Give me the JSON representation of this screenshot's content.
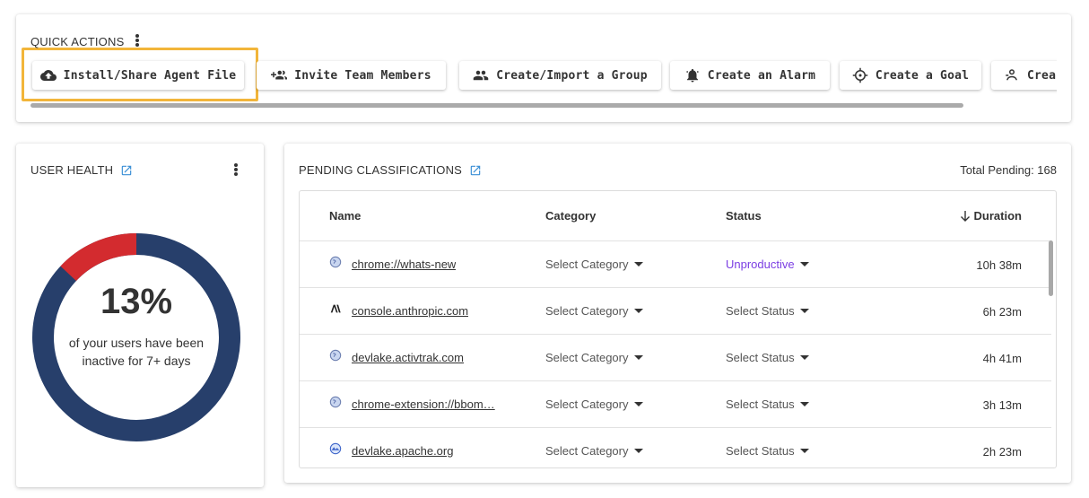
{
  "quick_actions": {
    "title": "QUICK ACTIONS",
    "buttons": [
      {
        "label": "Install/Share Agent File",
        "icon": "cloud-upload-icon"
      },
      {
        "label": "Invite Team Members",
        "icon": "add-people-icon"
      },
      {
        "label": "Create/Import a Group",
        "icon": "group-icon"
      },
      {
        "label": "Create an Alarm",
        "icon": "alarm-bell-icon"
      },
      {
        "label": "Create a Goal",
        "icon": "crosshair-icon"
      },
      {
        "label": "Crea",
        "icon": "person-badge-icon"
      }
    ],
    "highlight_color": "#f2b53a"
  },
  "user_health": {
    "title": "USER HEALTH",
    "percent": "13%",
    "percent_value": 13,
    "description": "of your users have been inactive for 7+ days",
    "colors": {
      "inactive": "#d32b2f",
      "active": "#273f6b"
    }
  },
  "pending": {
    "title": "PENDING CLASSIFICATIONS",
    "total_label": "Total Pending: 168",
    "columns": {
      "name": "Name",
      "category": "Category",
      "status": "Status",
      "duration": "Duration"
    },
    "rows": [
      {
        "name": "chrome://whats-new",
        "category": "Select Category",
        "status": "Unproductive",
        "duration": "10h 38m",
        "icon": "globe-icon"
      },
      {
        "name": "console.anthropic.com",
        "category": "Select Category",
        "status": "Select Status",
        "duration": "6h 23m",
        "icon": "anthropic-logo-icon"
      },
      {
        "name": "devlake.activtrak.com",
        "category": "Select Category",
        "status": "Select Status",
        "duration": "4h 41m",
        "icon": "globe-icon"
      },
      {
        "name": "chrome-extension://bbom…",
        "category": "Select Category",
        "status": "Select Status",
        "duration": "3h 13m",
        "icon": "globe-icon"
      },
      {
        "name": "devlake.apache.org",
        "category": "Select Category",
        "status": "Select Status",
        "duration": "2h 23m",
        "icon": "devlake-logo-icon"
      }
    ],
    "unproductive_color": "#7b3ee3"
  }
}
